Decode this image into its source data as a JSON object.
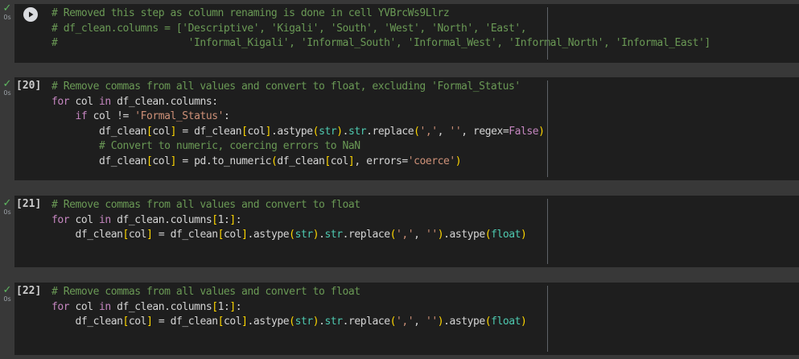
{
  "cells": [
    {
      "status_time": "0s",
      "exec_count": "",
      "has_run_button": true,
      "lines": [
        [
          {
            "t": "# Removed this step as column renaming is done in cell YVBrcWs9Llrz",
            "c": "cm"
          }
        ],
        [
          {
            "t": "# df_clean.columns = ['Descriptive', 'Kigali', 'South', 'West', 'North', 'East',",
            "c": "cm"
          }
        ],
        [
          {
            "t": "#                      'Informal_Kigali', 'Informal_South', 'Informal_West', 'Informal_North', 'Informal_East']",
            "c": "cm"
          }
        ]
      ]
    },
    {
      "status_time": "0s",
      "exec_count": "[20]",
      "has_run_button": false,
      "lines": [
        [
          {
            "t": "# Remove commas from all values and convert to float, excluding 'Formal_Status'",
            "c": "cm"
          }
        ],
        [
          {
            "t": "for",
            "c": "kw"
          },
          {
            "t": " col ",
            "c": "def"
          },
          {
            "t": "in",
            "c": "kw"
          },
          {
            "t": " df_clean.columns:",
            "c": "def"
          }
        ],
        [
          {
            "t": "    ",
            "c": "def"
          },
          {
            "t": "if",
            "c": "kw"
          },
          {
            "t": " col != ",
            "c": "def"
          },
          {
            "t": "'Formal_Status'",
            "c": "str"
          },
          {
            "t": ":",
            "c": "def"
          }
        ],
        [
          {
            "t": "        df_clean",
            "c": "def"
          },
          {
            "t": "[",
            "c": "br"
          },
          {
            "t": "col",
            "c": "def"
          },
          {
            "t": "]",
            "c": "br"
          },
          {
            "t": " = df_clean",
            "c": "def"
          },
          {
            "t": "[",
            "c": "br"
          },
          {
            "t": "col",
            "c": "def"
          },
          {
            "t": "]",
            "c": "br"
          },
          {
            "t": ".astype",
            "c": "def"
          },
          {
            "t": "(",
            "c": "br"
          },
          {
            "t": "str",
            "c": "fn"
          },
          {
            "t": ")",
            "c": "br"
          },
          {
            "t": ".",
            "c": "def"
          },
          {
            "t": "str",
            "c": "fn"
          },
          {
            "t": ".replace",
            "c": "def"
          },
          {
            "t": "(",
            "c": "br"
          },
          {
            "t": "','",
            "c": "str"
          },
          {
            "t": ", ",
            "c": "def"
          },
          {
            "t": "''",
            "c": "str"
          },
          {
            "t": ", regex=",
            "c": "def"
          },
          {
            "t": "False",
            "c": "kw"
          },
          {
            "t": ")",
            "c": "br"
          }
        ],
        [
          {
            "t": "        ",
            "c": "def"
          },
          {
            "t": "# Convert to numeric, coercing errors to NaN",
            "c": "cm"
          }
        ],
        [
          {
            "t": "        df_clean",
            "c": "def"
          },
          {
            "t": "[",
            "c": "br"
          },
          {
            "t": "col",
            "c": "def"
          },
          {
            "t": "]",
            "c": "br"
          },
          {
            "t": " = pd.to_numeric",
            "c": "def"
          },
          {
            "t": "(",
            "c": "br"
          },
          {
            "t": "df_clean",
            "c": "def"
          },
          {
            "t": "[",
            "c": "br"
          },
          {
            "t": "col",
            "c": "def"
          },
          {
            "t": "]",
            "c": "br"
          },
          {
            "t": ", errors=",
            "c": "def"
          },
          {
            "t": "'coerce'",
            "c": "str"
          },
          {
            "t": ")",
            "c": "br"
          }
        ]
      ]
    },
    {
      "status_time": "0s",
      "exec_count": "[21]",
      "has_run_button": false,
      "lines": [
        [
          {
            "t": "# Remove commas from all values and convert to float",
            "c": "cm"
          }
        ],
        [
          {
            "t": "for",
            "c": "kw"
          },
          {
            "t": " col ",
            "c": "def"
          },
          {
            "t": "in",
            "c": "kw"
          },
          {
            "t": " df_clean.columns",
            "c": "def"
          },
          {
            "t": "[",
            "c": "br"
          },
          {
            "t": "1:",
            "c": "def"
          },
          {
            "t": "]",
            "c": "br"
          },
          {
            "t": ":",
            "c": "def"
          }
        ],
        [
          {
            "t": "    df_clean",
            "c": "def"
          },
          {
            "t": "[",
            "c": "br"
          },
          {
            "t": "col",
            "c": "def"
          },
          {
            "t": "]",
            "c": "br"
          },
          {
            "t": " = df_clean",
            "c": "def"
          },
          {
            "t": "[",
            "c": "br"
          },
          {
            "t": "col",
            "c": "def"
          },
          {
            "t": "]",
            "c": "br"
          },
          {
            "t": ".astype",
            "c": "def"
          },
          {
            "t": "(",
            "c": "br"
          },
          {
            "t": "str",
            "c": "fn"
          },
          {
            "t": ")",
            "c": "br"
          },
          {
            "t": ".",
            "c": "def"
          },
          {
            "t": "str",
            "c": "fn"
          },
          {
            "t": ".replace",
            "c": "def"
          },
          {
            "t": "(",
            "c": "br"
          },
          {
            "t": "','",
            "c": "str"
          },
          {
            "t": ", ",
            "c": "def"
          },
          {
            "t": "''",
            "c": "str"
          },
          {
            "t": ")",
            "c": "br"
          },
          {
            "t": ".astype",
            "c": "def"
          },
          {
            "t": "(",
            "c": "br"
          },
          {
            "t": "float",
            "c": "fn"
          },
          {
            "t": ")",
            "c": "br"
          }
        ]
      ]
    },
    {
      "status_time": "0s",
      "exec_count": "[22]",
      "has_run_button": false,
      "lines": [
        [
          {
            "t": "# Remove commas from all values and convert to float",
            "c": "cm"
          }
        ],
        [
          {
            "t": "for",
            "c": "kw"
          },
          {
            "t": " col ",
            "c": "def"
          },
          {
            "t": "in",
            "c": "kw"
          },
          {
            "t": " df_clean.columns",
            "c": "def"
          },
          {
            "t": "[",
            "c": "br"
          },
          {
            "t": "1:",
            "c": "def"
          },
          {
            "t": "]",
            "c": "br"
          },
          {
            "t": ":",
            "c": "def"
          }
        ],
        [
          {
            "t": "    df_clean",
            "c": "def"
          },
          {
            "t": "[",
            "c": "br"
          },
          {
            "t": "col",
            "c": "def"
          },
          {
            "t": "]",
            "c": "br"
          },
          {
            "t": " = df_clean",
            "c": "def"
          },
          {
            "t": "[",
            "c": "br"
          },
          {
            "t": "col",
            "c": "def"
          },
          {
            "t": "]",
            "c": "br"
          },
          {
            "t": ".astype",
            "c": "def"
          },
          {
            "t": "(",
            "c": "br"
          },
          {
            "t": "str",
            "c": "fn"
          },
          {
            "t": ")",
            "c": "br"
          },
          {
            "t": ".",
            "c": "def"
          },
          {
            "t": "str",
            "c": "fn"
          },
          {
            "t": ".replace",
            "c": "def"
          },
          {
            "t": "(",
            "c": "br"
          },
          {
            "t": "','",
            "c": "str"
          },
          {
            "t": ", ",
            "c": "def"
          },
          {
            "t": "''",
            "c": "str"
          },
          {
            "t": ")",
            "c": "br"
          },
          {
            "t": ".astype",
            "c": "def"
          },
          {
            "t": "(",
            "c": "br"
          },
          {
            "t": "float",
            "c": "fn"
          },
          {
            "t": ")",
            "c": "br"
          }
        ]
      ]
    }
  ],
  "icons": {
    "status": "checkmark-icon",
    "run": "play-icon"
  },
  "colors": {
    "comment": "#6a9955",
    "keyword": "#c586c0",
    "string": "#ce9178",
    "builtin": "#4ec9b0",
    "bracket": "#ffd700",
    "success": "#5fb760"
  }
}
